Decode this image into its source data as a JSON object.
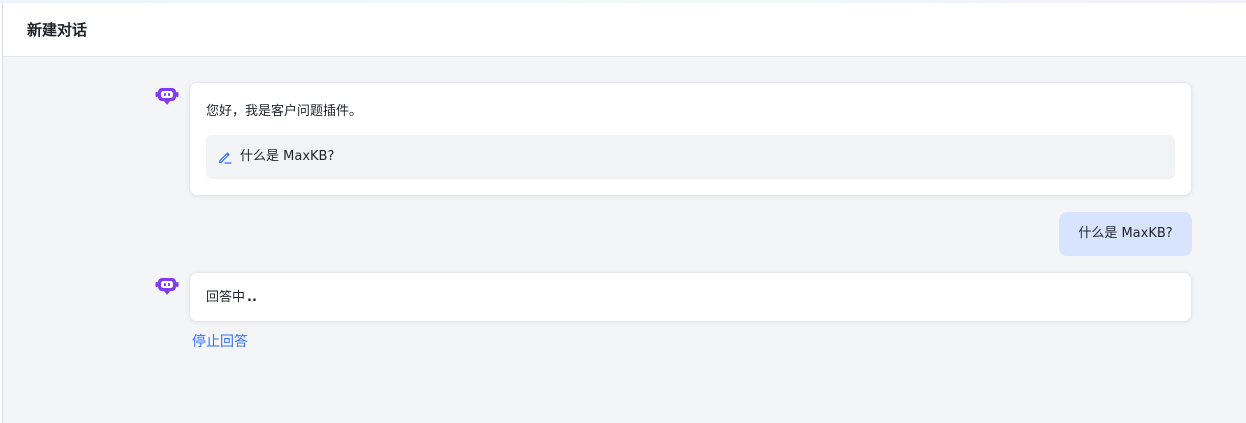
{
  "header": {
    "title": "新建对话"
  },
  "messages": {
    "greeting": {
      "text": "您好，我是客户问题插件。",
      "suggestion": {
        "icon": "pencil-icon",
        "label": "什么是 MaxKB?"
      }
    },
    "user_question": {
      "text": "什么是 MaxKB?"
    },
    "answer": {
      "status_text": "回答中",
      "loading_dots": ".."
    }
  },
  "actions": {
    "stop_label": "停止回答"
  },
  "icons": {
    "assistant_avatar": "robot-icon"
  },
  "colors": {
    "accent": "#3370ff",
    "avatar": "#7f3bf5",
    "user_bubble": "#d8e4fd",
    "content_bg": "#f4f5f7"
  }
}
